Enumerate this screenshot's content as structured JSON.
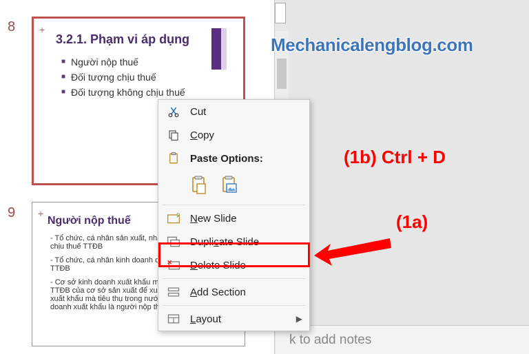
{
  "watermark": "Mechanicalengblog.com",
  "annotations": {
    "label_1b": "(1b) Ctrl + D",
    "label_1a": "(1a)"
  },
  "slides": {
    "s8": {
      "number": "8",
      "title": "3.2.1. Phạm vi áp dụng",
      "bullets": [
        "Người nộp thuế",
        "Đối tượng chịu thuế",
        "Đối tượng không chịu thuế"
      ]
    },
    "s9": {
      "number": "9",
      "title": "Người nộp thuế",
      "lines": [
        "- Tổ chức, cá nhân sản xuất, nhập khẩu hàng hoá chịu thuế TTĐB",
        "- Tổ chức, cá nhân kinh doanh dịch vụ chịu thuế TTĐB",
        "- Cơ sở kinh doanh xuất khẩu mua hàng chịu thuế TTĐB của cơ sở sản xuất để xuất khẩu nhưng không xuất khẩu mà tiêu thụ trong nước thì cơ sở kinh doanh xuất khẩu là người nộp thuế"
      ]
    }
  },
  "menu": {
    "cut": "Cut",
    "copy": "Copy",
    "paste_options": "Paste Options:",
    "new_slide": "New Slide",
    "duplicate_slide": "Duplicate Slide",
    "delete_slide": "Delete Slide",
    "add_section": "Add Section",
    "layout": "Layout"
  },
  "notes": "k to add notes"
}
